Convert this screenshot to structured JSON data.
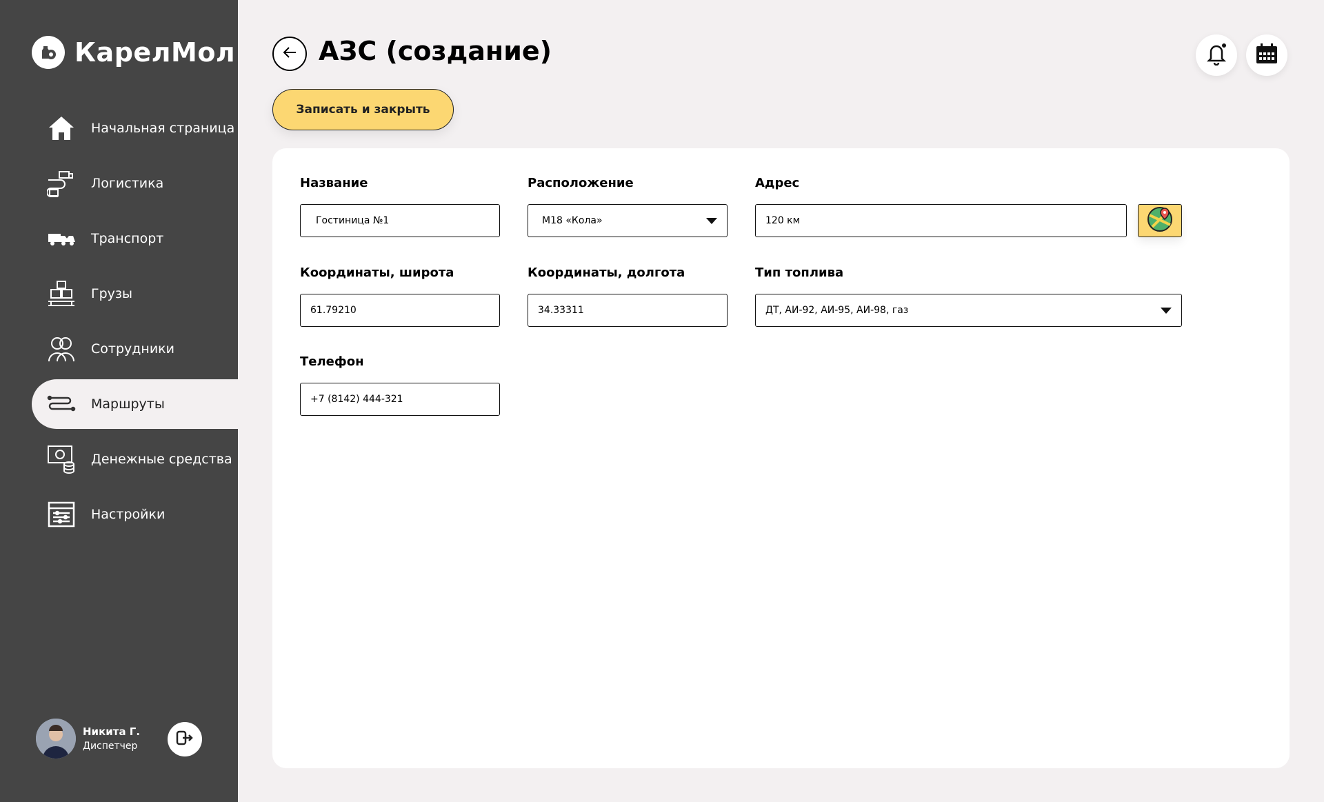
{
  "app": {
    "name": "КарелМол"
  },
  "sidebar": {
    "items": [
      {
        "label": "Начальная страница",
        "icon": "home-icon"
      },
      {
        "label": "Логистика",
        "icon": "logistics-icon"
      },
      {
        "label": "Транспорт",
        "icon": "transport-icon"
      },
      {
        "label": "Грузы",
        "icon": "cargo-icon"
      },
      {
        "label": "Сотрудники",
        "icon": "employees-icon"
      },
      {
        "label": "Маршруты",
        "icon": "routes-icon",
        "active": true
      },
      {
        "label": "Денежные средства",
        "icon": "money-icon"
      },
      {
        "label": "Настройки",
        "icon": "settings-icon"
      }
    ]
  },
  "user": {
    "name": "Никита Г.",
    "role": "Диспетчер"
  },
  "header": {
    "title": "АЗС (создание)",
    "save_label": "Записать и закрыть"
  },
  "form": {
    "name": {
      "label": "Название",
      "value": "Гостиница №1"
    },
    "location": {
      "label": "Расположение",
      "value": "М18 «Кола»"
    },
    "address": {
      "label": "Адрес",
      "value": "120 км"
    },
    "latitude": {
      "label": "Координаты, широта",
      "value": "61.79210"
    },
    "longitude": {
      "label": "Координаты, долгота",
      "value": "34.33311"
    },
    "fuel": {
      "label": "Тип топлива",
      "value": "ДТ, АИ-92, АИ-95, АИ-98, газ"
    },
    "phone": {
      "label": "Телефон",
      "value": "+7 (8142) 444-321"
    }
  },
  "colors": {
    "sidebar": "#454545",
    "background": "#f3f0f1",
    "accent": "#fcd772"
  }
}
